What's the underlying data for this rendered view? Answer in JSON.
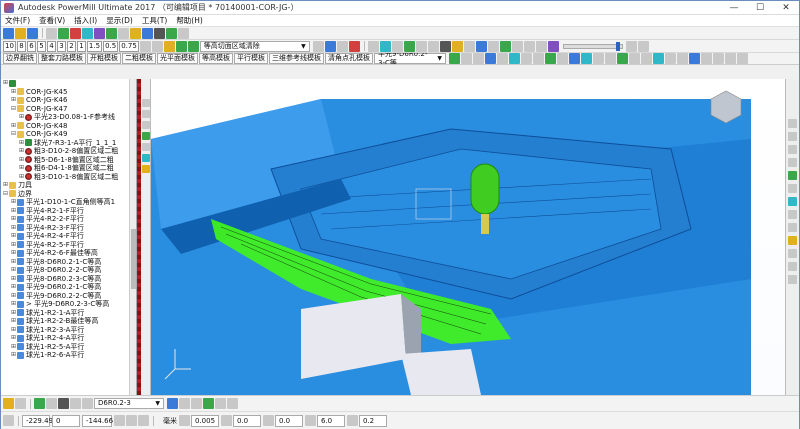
{
  "window": {
    "title": "Autodesk PowerMill Ultimate 2017  （可编辑项目 * 70140001-COR-JG-）",
    "minimize": "—",
    "maximize": "☐",
    "close": "✕"
  },
  "menu": [
    "文件(F)",
    "查看(V)",
    "插入(I)",
    "显示(D)",
    "工具(T)",
    "帮助(H)"
  ],
  "toolbar2": {
    "numbers": [
      "10",
      "8",
      "6",
      "5",
      "4",
      "3",
      "2",
      "1",
      "1.5",
      "0.5",
      "0.75"
    ],
    "strategy_combo": "等高切面区域清除"
  },
  "template_tabs": [
    "边界翻铣",
    "整套刀路模板",
    "开粗模板",
    "二粗模板",
    "光平面模板",
    "等高模板",
    "平行模板",
    "三维参考线模板",
    "清角点孔模板"
  ],
  "active_toolpath_combo": "平光9-D6R0.2-3-C等",
  "explorer": {
    "rows": [
      {
        "indent": 0,
        "exp": "⊞",
        "icon": "tp",
        "text": ""
      },
      {
        "indent": 1,
        "exp": "⊞",
        "icon": "folder",
        "text": "COR-JG-K45"
      },
      {
        "indent": 1,
        "exp": "⊞",
        "icon": "folder",
        "text": "COR-JG-K46"
      },
      {
        "indent": 1,
        "exp": "⊟",
        "icon": "folder",
        "text": "COR-JG-K47"
      },
      {
        "indent": 2,
        "exp": "⊞",
        "icon": "tpx",
        "text": "平光23-D0.08-1-F参考线"
      },
      {
        "indent": 1,
        "exp": "⊞",
        "icon": "folder",
        "text": "COR-JG-K48"
      },
      {
        "indent": 1,
        "exp": "⊟",
        "icon": "folder",
        "text": "COR-JG-K49"
      },
      {
        "indent": 2,
        "exp": "⊞",
        "icon": "tp",
        "text": "球光7-R3-1-A平行_1_1_1"
      },
      {
        "indent": 2,
        "exp": "⊞",
        "icon": "tpx",
        "text": "粗3-D10-2-8偏置区域二粗"
      },
      {
        "indent": 2,
        "exp": "⊞",
        "icon": "tpx",
        "text": "粗5-D6-1-8偏置区域二粗"
      },
      {
        "indent": 2,
        "exp": "⊞",
        "icon": "tpx",
        "text": "粗6-D4-1-8偏置区域二粗"
      },
      {
        "indent": 2,
        "exp": "⊞",
        "icon": "tpx",
        "text": "粗3-D10-1-8偏置区域二粗"
      },
      {
        "indent": 0,
        "exp": "⊞",
        "icon": "folder",
        "text": "刀具"
      },
      {
        "indent": 0,
        "exp": "⊟",
        "icon": "folder",
        "text": "边界"
      },
      {
        "indent": 1,
        "exp": "⊞",
        "icon": "bnd",
        "text": "平光1-D10-1-C直角侧等高1"
      },
      {
        "indent": 1,
        "exp": "⊞",
        "icon": "bnd",
        "text": "平光4-R2-1-F平行"
      },
      {
        "indent": 1,
        "exp": "⊞",
        "icon": "bnd",
        "text": "平光4-R2-2-F平行"
      },
      {
        "indent": 1,
        "exp": "⊞",
        "icon": "bnd",
        "text": "平光4-R2-3-F平行"
      },
      {
        "indent": 1,
        "exp": "⊞",
        "icon": "bnd",
        "text": "平光4-R2-4-F平行"
      },
      {
        "indent": 1,
        "exp": "⊞",
        "icon": "bnd",
        "text": "平光4-R2-5-F平行"
      },
      {
        "indent": 1,
        "exp": "⊞",
        "icon": "bnd",
        "text": "平光4-R2-6-F最佳等高"
      },
      {
        "indent": 1,
        "exp": "⊞",
        "icon": "bnd",
        "text": "平光8-D6R0.2-1-C等高"
      },
      {
        "indent": 1,
        "exp": "⊞",
        "icon": "bnd",
        "text": "平光8-D6R0.2-2-C等高"
      },
      {
        "indent": 1,
        "exp": "⊞",
        "icon": "bnd",
        "text": "平光8-D6R0.2-3-C等高"
      },
      {
        "indent": 1,
        "exp": "⊞",
        "icon": "bnd",
        "text": "平光9-D6R0.2-1-C等高"
      },
      {
        "indent": 1,
        "exp": "⊞",
        "icon": "bnd",
        "text": "平光9-D6R0.2-2-C等高"
      },
      {
        "indent": 1,
        "exp": "⊞",
        "icon": "bnd",
        "text": "> 平光9-D6R0.2-3-C等高"
      },
      {
        "indent": 1,
        "exp": "⊞",
        "icon": "bnd",
        "text": "球光1-R2-1-A平行"
      },
      {
        "indent": 1,
        "exp": "⊞",
        "icon": "bnd",
        "text": "球光1-R2-2-B最佳等高"
      },
      {
        "indent": 1,
        "exp": "⊞",
        "icon": "bnd",
        "text": "球光1-R2-3-A平行"
      },
      {
        "indent": 1,
        "exp": "⊞",
        "icon": "bnd",
        "text": "球光1-R2-4-A平行"
      },
      {
        "indent": 1,
        "exp": "⊞",
        "icon": "bnd",
        "text": "球光1-R2-5-A平行"
      },
      {
        "indent": 1,
        "exp": "⊞",
        "icon": "bnd",
        "text": "球光1-R2-6-A平行"
      }
    ]
  },
  "bottom1": {
    "tool_combo": "D6R0.2-3"
  },
  "statusbar": {
    "x": "-229.49",
    "y": "0",
    "z": "-144.66",
    "unit": "毫米",
    "tolerance": "0.005",
    "thickness": "0.0",
    "axial_thickness": "0.0",
    "diameter": "6.0",
    "corner": "0.2"
  },
  "colors": {
    "model_blue": "#2a8ee0",
    "model_dark": "#1060b0",
    "toolpath_green": "#40f020",
    "tool_green": "#40cc20",
    "tool_tip": "#d8c850"
  }
}
